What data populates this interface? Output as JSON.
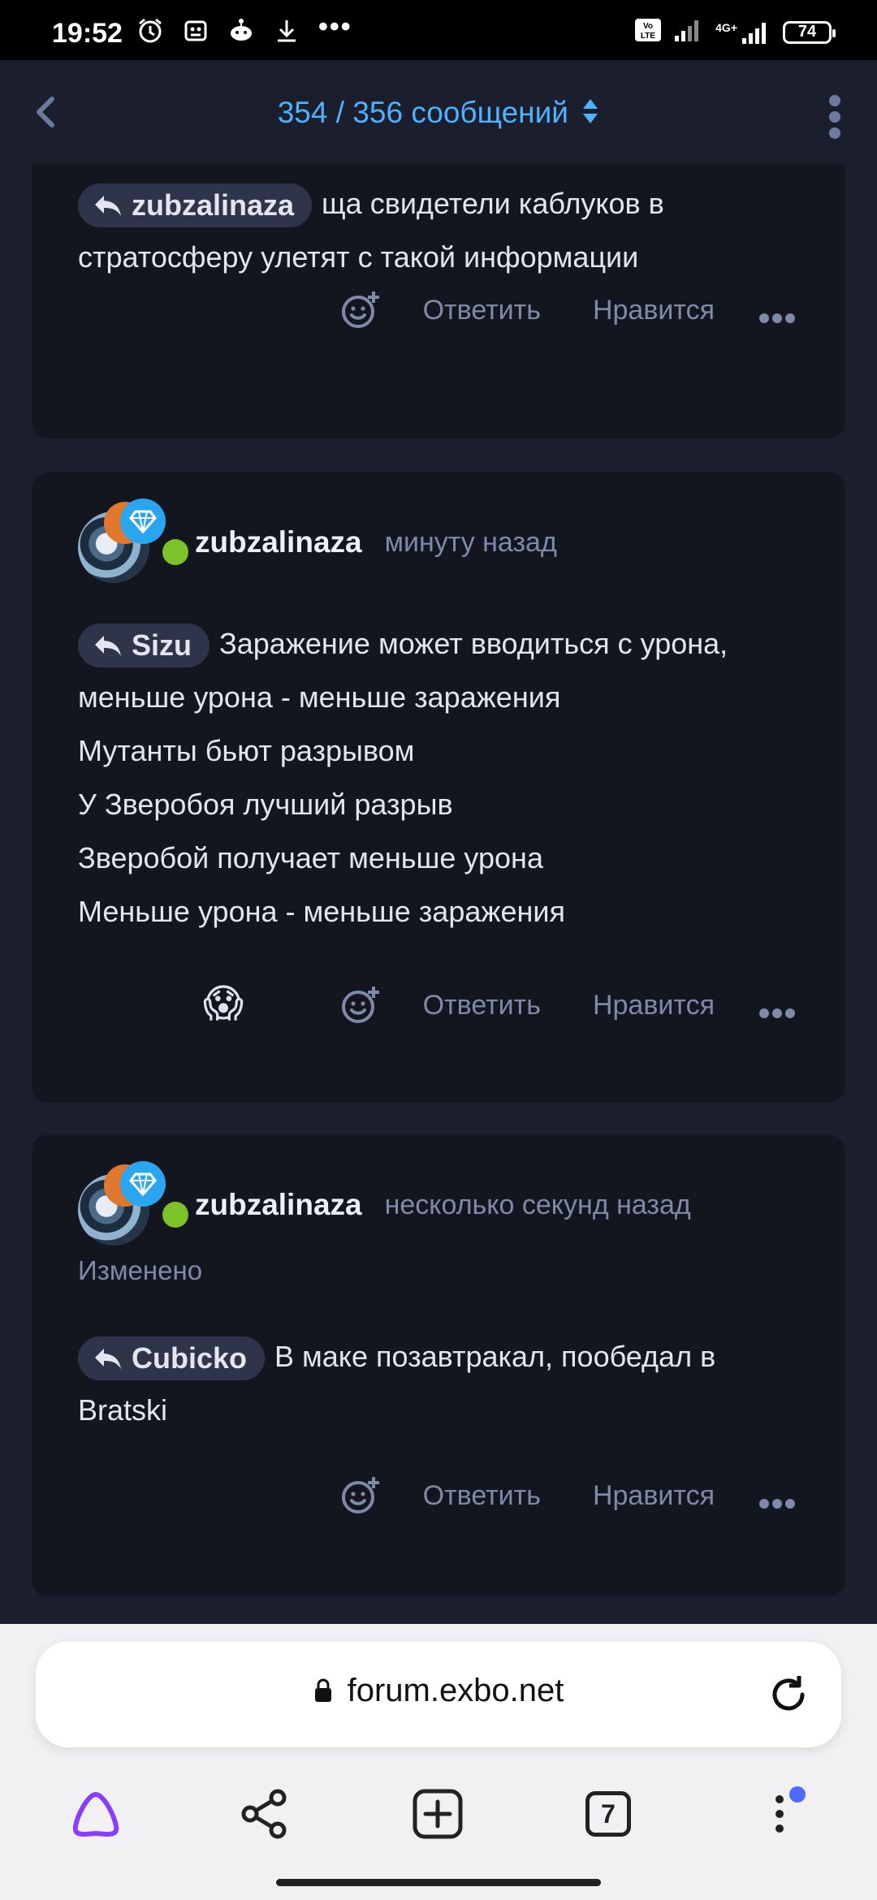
{
  "status_bar": {
    "time": "19:52",
    "battery": "74",
    "network_label": "4G+",
    "icons": [
      "alarm-icon",
      "app-icon",
      "reddit-icon",
      "download-icon",
      "more-dots-icon",
      "volte-icon",
      "signal-icon",
      "battery-icon"
    ]
  },
  "header": {
    "counter": "354 / 356 сообщений",
    "accent_color": "#4fb2ff"
  },
  "posts": [
    {
      "reply_to": "zubzalinaza",
      "text_inline": "ща свидетели каблуков в",
      "lines": [
        "стратосферу улетят с такой информации"
      ],
      "actions": {
        "reply": "Ответить",
        "like": "Нравится"
      }
    },
    {
      "author": "zubzalinaza",
      "time": "минуту назад",
      "reply_to": "Sizu",
      "text_inline": "Заражение может вводиться с урона,",
      "lines": [
        "меньше урона - меньше заражения",
        "Мутанты бьют разрывом",
        "У Зверобоя лучший разрыв",
        "Зверобой получает меньше урона",
        "Меньше урона - меньше заражения"
      ],
      "reaction_emoji": "😱",
      "actions": {
        "reply": "Ответить",
        "like": "Нравится"
      }
    },
    {
      "author": "zubzalinaza",
      "time": "несколько секунд назад",
      "edited": "Изменено",
      "reply_to": "Cubicko",
      "text_inline": "В маке позавтракал, пообедал в",
      "lines": [
        "Bratski"
      ],
      "actions": {
        "reply": "Ответить",
        "like": "Нравится"
      }
    }
  ],
  "browser": {
    "url": "forum.exbo.net",
    "tabs_count": "7"
  }
}
